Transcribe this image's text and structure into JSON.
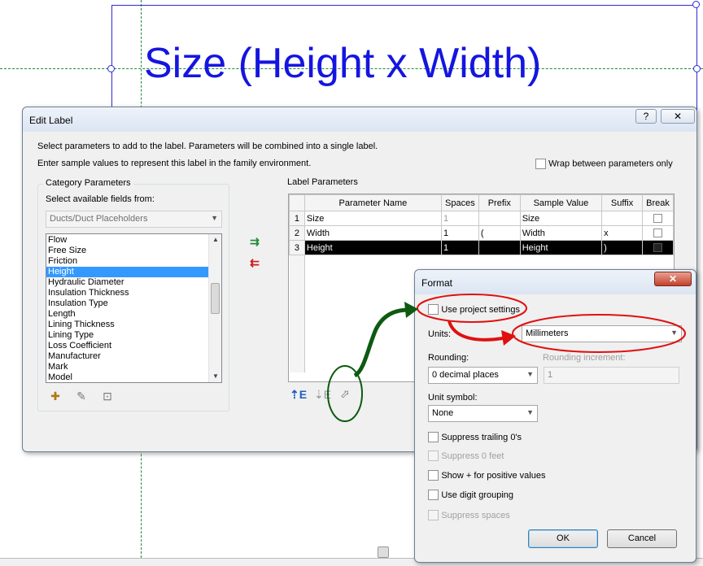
{
  "canvas": {
    "label_text": "Size (Height x Width)"
  },
  "edit_label": {
    "title": "Edit Label",
    "help": "?",
    "close": "✕",
    "instruction1": "Select parameters to add to the label.  Parameters will be combined into a single label.",
    "instruction2": "Enter sample values to represent this label in the family environment.",
    "wrap_label": "Wrap between parameters only",
    "category_parameters_title": "Category Parameters",
    "select_fields_label": "Select available fields from:",
    "fields_from": "Ducts/Duct Placeholders",
    "fields": [
      "Flow",
      "Free Size",
      "Friction",
      "Height",
      "Hydraulic Diameter",
      "Insulation Thickness",
      "Insulation Type",
      "Length",
      "Lining Thickness",
      "Lining Type",
      "Loss Coefficient",
      "Manufacturer",
      "Mark",
      "Model"
    ],
    "selected_field": "Height",
    "label_parameters_title": "Label Parameters",
    "columns": [
      "",
      "Parameter Name",
      "Spaces",
      "Prefix",
      "Sample Value",
      "Suffix",
      "Break"
    ],
    "rows": [
      {
        "num": "1",
        "name": "Size",
        "spaces": "1",
        "prefix": "",
        "sample": "Size",
        "suffix": ""
      },
      {
        "num": "2",
        "name": "Width",
        "spaces": "1",
        "prefix": "(",
        "sample": "Width",
        "suffix": "x"
      },
      {
        "num": "3",
        "name": "Height",
        "spaces": "1",
        "prefix": "",
        "sample": "Height",
        "suffix": ")"
      }
    ]
  },
  "format": {
    "title": "Format",
    "close": "✕",
    "use_project_settings": "Use project settings",
    "units_label": "Units:",
    "units_value": "Millimeters",
    "rounding_label": "Rounding:",
    "rounding_value": "0 decimal places",
    "rounding_increment_label": "Rounding increment:",
    "rounding_increment_value": "1",
    "unit_symbol_label": "Unit symbol:",
    "unit_symbol_value": "None",
    "suppress_trailing": "Suppress trailing 0's",
    "suppress_feet": "Suppress 0 feet",
    "show_plus": "Show + for positive values",
    "digit_grouping": "Use digit grouping",
    "suppress_spaces": "Suppress spaces",
    "ok": "OK",
    "cancel": "Cancel"
  },
  "colors": {
    "label_blue": "#1515e0",
    "annotation_red": "#e01010",
    "annotation_green": "#0d5a10",
    "selection_blue": "#3399ff"
  }
}
